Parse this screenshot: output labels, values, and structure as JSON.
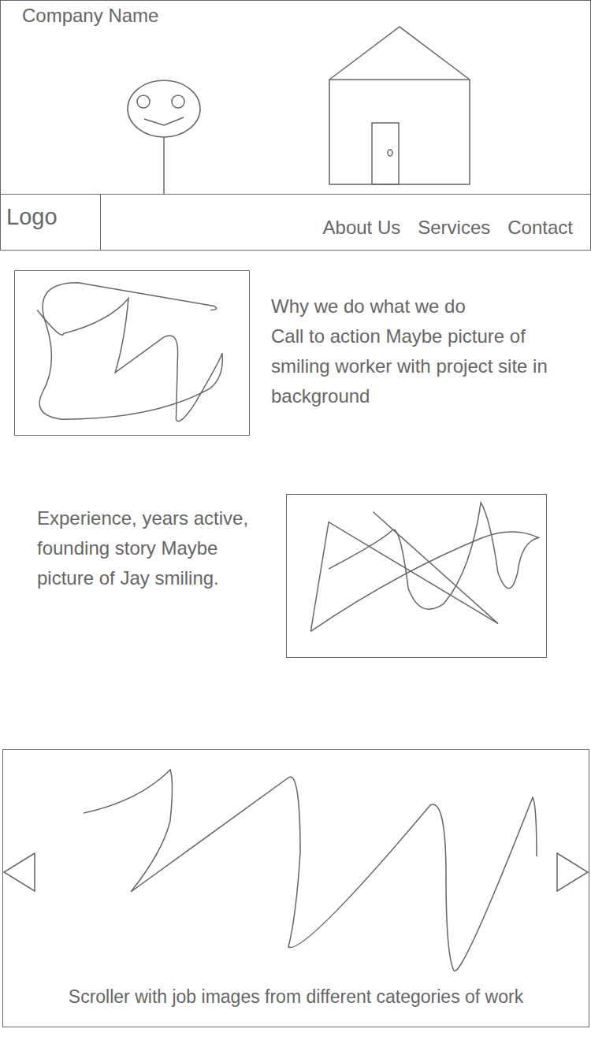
{
  "header": {
    "company_name": "Company Name"
  },
  "nav": {
    "logo": "Logo",
    "links": [
      "About Us",
      "Services",
      "Contact"
    ]
  },
  "intro": {
    "heading": "Why we do what we do",
    "body": "Call to action Maybe picture of smiling worker with project site in background"
  },
  "story": {
    "body": "Experience, years active, founding story Maybe picture of Jay smiling."
  },
  "carousel": {
    "caption": "Scroller with job images from different categories of work"
  }
}
